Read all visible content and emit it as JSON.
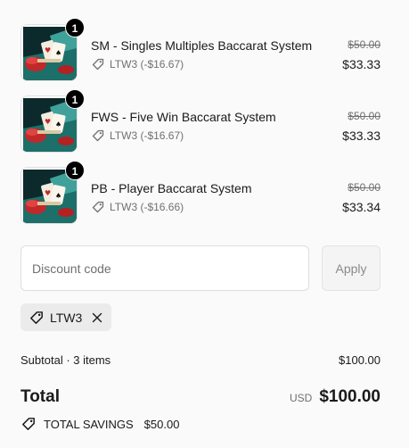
{
  "items": [
    {
      "title": "SM - Singles Multiples Baccarat System",
      "quantity": "1",
      "discount": "LTW3 (-$16.67)",
      "original_price": "$50.00",
      "final_price": "$33.33",
      "image_icon": "baccarat-cards-thumbnail"
    },
    {
      "title": "FWS - Five Win Baccarat System",
      "quantity": "1",
      "discount": "LTW3 (-$16.67)",
      "original_price": "$50.00",
      "final_price": "$33.33",
      "image_icon": "baccarat-cards-thumbnail"
    },
    {
      "title": "PB - Player Baccarat System",
      "quantity": "1",
      "discount": "LTW3 (-$16.66)",
      "original_price": "$50.00",
      "final_price": "$33.34",
      "image_icon": "baccarat-cards-thumbnail"
    }
  ],
  "discount_form": {
    "placeholder": "Discount code",
    "value": "",
    "apply_label": "Apply"
  },
  "applied_code": {
    "label": "LTW3"
  },
  "summary": {
    "subtotal_label": "Subtotal · 3 items",
    "subtotal_value": "$100.00",
    "total_label": "Total",
    "currency": "USD",
    "total_value": "$100.00",
    "savings_label": "TOTAL SAVINGS",
    "savings_value": "$50.00"
  },
  "colors": {
    "text": "#1a1a1a",
    "muted": "#707070",
    "badge": "#000000",
    "chip_bg": "#ebebeb",
    "thumb_felt": "#1d6f6a",
    "thumb_red": "#c0282a"
  }
}
